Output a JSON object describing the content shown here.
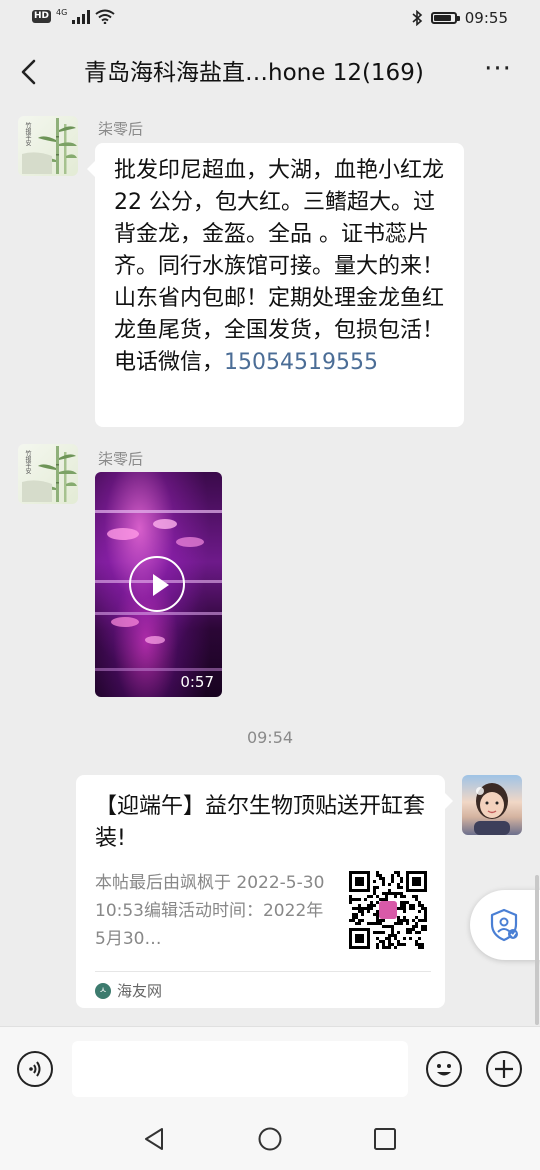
{
  "status_bar": {
    "network_badge": "HD",
    "network_type": "4G",
    "time": "09:55",
    "battery_level": 0.85
  },
  "header": {
    "title": "青岛海科海盐直…hone 12(169)",
    "more_label": "···"
  },
  "messages": [
    {
      "sender": "柒零后",
      "avatar_text": "竹报平安",
      "text": "批发印尼超血，大湖，血艳小红龙 22 公分，包大红。三鳍超大。过背金龙，金盔。全品 。证书蕊片齐。同行水族馆可接。量大的来！山东省内包邮！定期处理金龙鱼红龙鱼尾货，全国发货，包损包活！电话微信，",
      "phone": "15054519555"
    },
    {
      "sender": "柒零后",
      "avatar_text": "竹报平安",
      "video_duration": "0:57"
    }
  ],
  "timestamp": "09:54",
  "link_card": {
    "title": "【迎端午】益尔生物顶贴送开缸套装!",
    "description": "本帖最后由飒枫于 2022-5-3010:53编辑活动时间：2022年5月30…",
    "source_logo": "ㅅ",
    "source": "海友网"
  },
  "icons": {
    "back": "back-arrow-icon",
    "more": "more-icon",
    "voice": "voice-icon",
    "emoji": "emoji-icon",
    "add": "add-icon",
    "shield": "shield-icon",
    "play": "play-icon"
  },
  "colors": {
    "background": "#ededed",
    "bubble": "#ffffff",
    "phone_link": "#4b6d96"
  }
}
